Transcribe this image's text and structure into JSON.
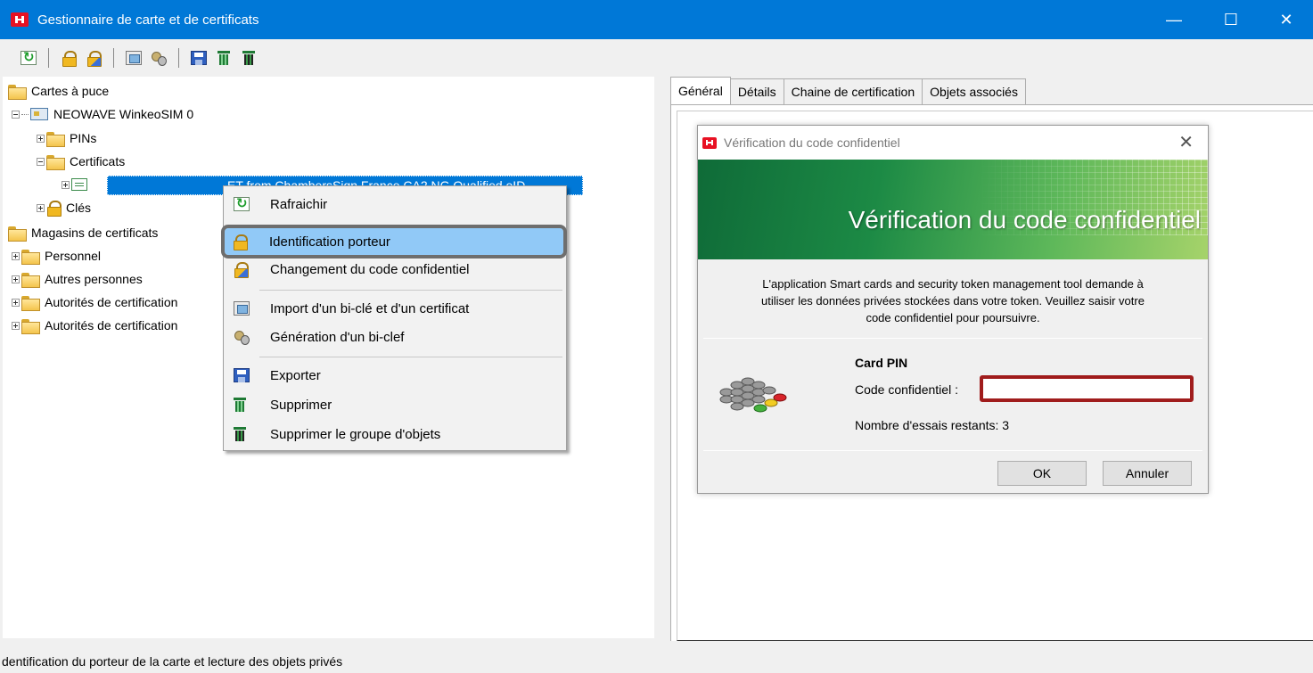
{
  "window": {
    "title": "Gestionnaire de carte et de certificats",
    "minimize": "—",
    "maximize": "☐",
    "close": "✕"
  },
  "toolbar": {
    "icons": [
      "refresh-icon",
      "lock-icon",
      "change-pin-icon",
      "import-icon",
      "key-generation-icon",
      "save-icon",
      "trash-icon",
      "trash-group-icon"
    ]
  },
  "tree": {
    "root_smartcards": "Cartes à puce",
    "reader": "NEOWAVE WinkeoSIM 0",
    "pins": "PINs",
    "certificates": "Certificats",
    "selected_certificate": "ET from ChambersSign France CA2 NG Qualified eID",
    "keys": "Clés",
    "root_stores": "Magasins de certificats",
    "personal": "Personnel",
    "other_people": "Autres personnes",
    "ca1": "Autorités de certification",
    "ca2": "Autorités de certification"
  },
  "context_menu": {
    "items": [
      {
        "label": "Rafraichir"
      },
      {
        "label": "Identification porteur"
      },
      {
        "label": "Changement du code confidentiel"
      },
      {
        "label": "Import d'un bi-clé et d'un certificat"
      },
      {
        "label": "Génération d'un bi-clef"
      },
      {
        "label": "Exporter"
      },
      {
        "label": "Supprimer"
      },
      {
        "label": "Supprimer le groupe d'objets"
      }
    ],
    "active_index": 1
  },
  "tabs": [
    "Général",
    "Détails",
    "Chaine de certification",
    "Objets associés"
  ],
  "dialog": {
    "title": "Vérification du code confidentiel",
    "banner_heading": "Vérification du code confidentiel",
    "message_line1": "L'application Smart cards and security token management tool demande à",
    "message_line2": "utiliser les données privées stockées dans votre token. Veuillez saisir votre",
    "message_line3": "code confidentiel pour poursuivre.",
    "pin_section_title": "Card PIN",
    "pin_label": "Code confidentiel :",
    "pin_value": "",
    "tries_remaining": "Nombre d'essais restants: 3",
    "ok_label": "OK",
    "cancel_label": "Annuler",
    "close": "✕"
  },
  "statusbar": {
    "text": "dentification du porteur de la carte et lecture des objets privés"
  },
  "colors": {
    "titlebar": "#0078d7",
    "selection": "#0078d7",
    "menu_highlight": "#91c9f7",
    "pin_field_outline": "#a01c1c",
    "banner_green": "#1c8a45"
  }
}
